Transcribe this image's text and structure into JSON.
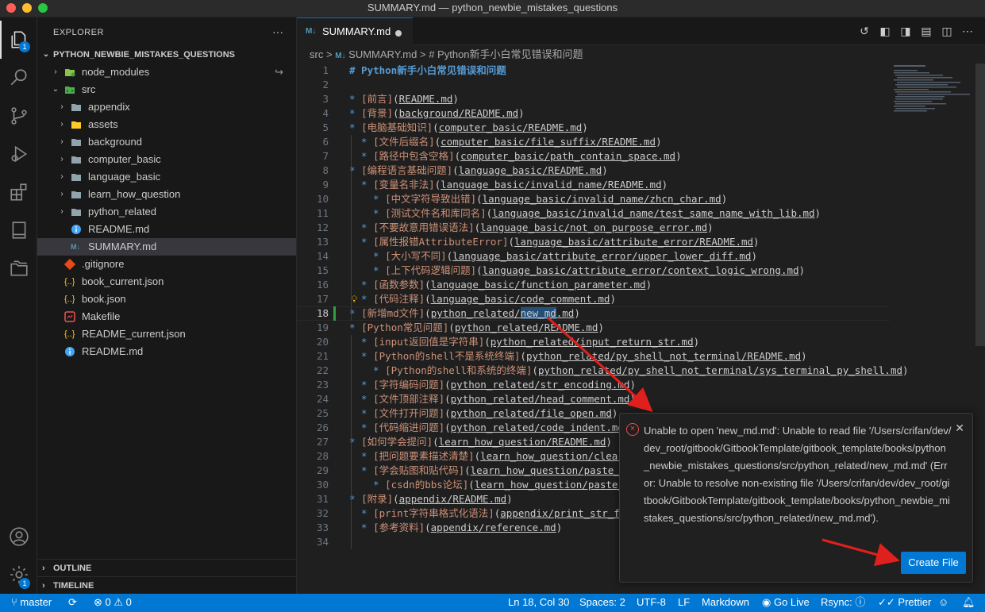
{
  "window": {
    "title": "SUMMARY.md — python_newbie_mistakes_questions"
  },
  "activity": {
    "explorer_badge": "1",
    "settings_badge": "1"
  },
  "sidebar": {
    "header": "EXPLORER",
    "root": "PYTHON_NEWBIE_MISTAKES_QUESTIONS",
    "items": [
      {
        "label": "node_modules"
      },
      {
        "label": "src"
      },
      {
        "label": "appendix"
      },
      {
        "label": "assets"
      },
      {
        "label": "background"
      },
      {
        "label": "computer_basic"
      },
      {
        "label": "language_basic"
      },
      {
        "label": "learn_how_question"
      },
      {
        "label": "python_related"
      },
      {
        "label": "README.md"
      },
      {
        "label": "SUMMARY.md"
      },
      {
        "label": ".gitignore"
      },
      {
        "label": "book_current.json"
      },
      {
        "label": "book.json"
      },
      {
        "label": "Makefile"
      },
      {
        "label": "README_current.json"
      },
      {
        "label": "README.md"
      }
    ],
    "outline": "OUTLINE",
    "timeline": "TIMELINE"
  },
  "tab": {
    "label": "SUMMARY.md",
    "icon_text": "M↓"
  },
  "breadcrumb": {
    "part1": "src",
    "sep1": ">",
    "part2": "SUMMARY.md",
    "sep2": ">",
    "part3": "# Python新手小白常见错误和问题"
  },
  "editor": {
    "lines": [
      {
        "n": "1",
        "heading": "# Python新手小白常见错误和问题"
      },
      {
        "n": "2"
      },
      {
        "n": "3",
        "indent": 0,
        "label": "[前言]",
        "link": "README.md"
      },
      {
        "n": "4",
        "indent": 0,
        "label": "[背景]",
        "link": "background/README.md"
      },
      {
        "n": "5",
        "indent": 0,
        "label": "[电脑基础知识]",
        "link": "computer_basic/README.md"
      },
      {
        "n": "6",
        "indent": 1,
        "label": "[文件后缀名]",
        "link": "computer_basic/file_suffix/README.md"
      },
      {
        "n": "7",
        "indent": 1,
        "label": "[路径中包含空格]",
        "link": "computer_basic/path_contain_space.md"
      },
      {
        "n": "8",
        "indent": 0,
        "label": "[编程语言基础问题]",
        "link": "language_basic/README.md"
      },
      {
        "n": "9",
        "indent": 1,
        "label": "[变量名非法]",
        "link": "language_basic/invalid_name/README.md"
      },
      {
        "n": "10",
        "indent": 2,
        "label": "[中文字符导致出错]",
        "link": "language_basic/invalid_name/zhcn_char.md"
      },
      {
        "n": "11",
        "indent": 2,
        "label": "[测试文件名和库同名]",
        "link": "language_basic/invalid_name/test_same_name_with_lib.md"
      },
      {
        "n": "12",
        "indent": 1,
        "label": "[不要故意用错误语法]",
        "link": "language_basic/not_on_purpose_error.md"
      },
      {
        "n": "13",
        "indent": 1,
        "label": "[属性报错AttributeError]",
        "link": "language_basic/attribute_error/README.md"
      },
      {
        "n": "14",
        "indent": 2,
        "label": "[大小写不同]",
        "link": "language_basic/attribute_error/upper_lower_diff.md"
      },
      {
        "n": "15",
        "indent": 2,
        "label": "[上下代码逻辑问题]",
        "link": "language_basic/attribute_error/context_logic_wrong.md"
      },
      {
        "n": "16",
        "indent": 1,
        "label": "[函数参数]",
        "link": "language_basic/function_parameter.md"
      },
      {
        "n": "17",
        "indent": 1,
        "label": "[代码注释]",
        "link": "language_basic/code_comment.md"
      },
      {
        "n": "18",
        "indent": 0,
        "label": "[新增md文件]",
        "link": "python_related/new_md.md",
        "current": true
      },
      {
        "n": "19",
        "indent": 0,
        "label": "[Python常见问题]",
        "link": "python_related/README.md"
      },
      {
        "n": "20",
        "indent": 1,
        "label": "[input返回值是字符串]",
        "link": "python_related/input_return_str.md"
      },
      {
        "n": "21",
        "indent": 1,
        "label": "[Python的shell不是系统终端]",
        "link": "python_related/py_shell_not_terminal/README.md"
      },
      {
        "n": "22",
        "indent": 2,
        "label": "[Python的shell和系统的终端]",
        "link": "python_related/py_shell_not_terminal/sys_terminal_py_shell.md"
      },
      {
        "n": "23",
        "indent": 1,
        "label": "[字符编码问题]",
        "link": "python_related/str_encoding.md"
      },
      {
        "n": "24",
        "indent": 1,
        "label": "[文件顶部注释]",
        "link": "python_related/head_comment.md"
      },
      {
        "n": "25",
        "indent": 1,
        "label": "[文件打开问题]",
        "link": "python_related/file_open.md"
      },
      {
        "n": "26",
        "indent": 1,
        "label": "[代码缩进问题]",
        "link": "python_related/code_indent.md"
      },
      {
        "n": "27",
        "indent": 0,
        "label": "[如何学会提问]",
        "link": "learn_how_question/README.md"
      },
      {
        "n": "28",
        "indent": 1,
        "label": "[把问题要素描述清楚]",
        "link": "learn_how_question/clear_"
      },
      {
        "n": "29",
        "indent": 1,
        "label": "[学会贴图和贴代码]",
        "link": "learn_how_question/paste_im"
      },
      {
        "n": "30",
        "indent": 2,
        "label": "[csdn的bbs论坛]",
        "link": "learn_how_question/paste_i"
      },
      {
        "n": "31",
        "indent": 0,
        "label": "[附录]",
        "link": "appendix/README.md"
      },
      {
        "n": "32",
        "indent": 1,
        "label": "[print字符串格式化语法]",
        "link": "appendix/print_str_for"
      },
      {
        "n": "33",
        "indent": 1,
        "label": "[参考资料]",
        "link": "appendix/reference.md"
      },
      {
        "n": "34"
      }
    ]
  },
  "notification": {
    "message": "Unable to open 'new_md.md': Unable to read file '/Users/crifan/dev/dev_root/gitbook/GitbookTemplate/gitbook_template/books/python_newbie_mistakes_questions/src/python_related/new_md.md' (Error: Unable to resolve non-existing file '/Users/crifan/dev/dev_root/gitbook/GitbookTemplate/gitbook_template/books/python_newbie_mistakes_questions/src/python_related/new_md.md').",
    "button": "Create File"
  },
  "status": {
    "branch": "master",
    "problems": "⊗ 0 ⚠ 0",
    "position": "Ln 18, Col 30",
    "spaces": "Spaces: 2",
    "encoding": "UTF-8",
    "eol": "LF",
    "language": "Markdown",
    "golive": "Go Live",
    "rsync": "Rsync: ⓘ",
    "prettier": "Prettier"
  },
  "colors": {
    "accent": "#0078d4",
    "error": "#f14c4c",
    "arrow": "#e0201c"
  }
}
